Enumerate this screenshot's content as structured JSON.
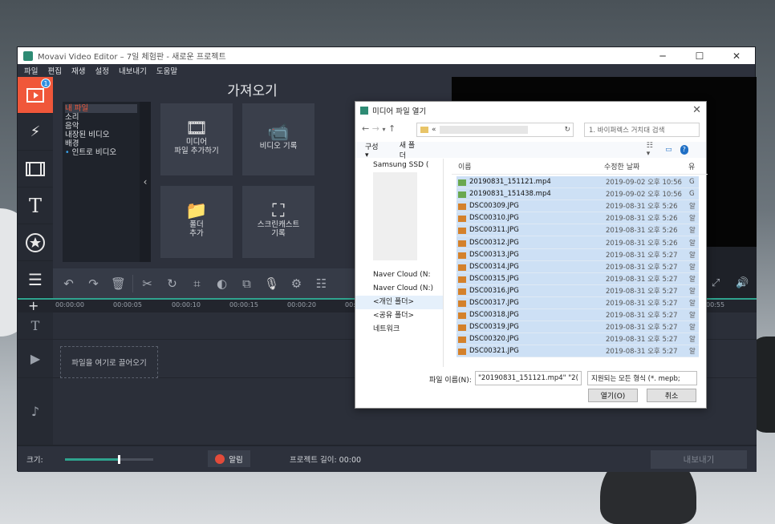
{
  "window": {
    "title": "Movavi Video Editor – 7일 체험판 - 새로운 프로젝트",
    "controls": [
      "─",
      "☐",
      "✕"
    ]
  },
  "menu": [
    "파일",
    "편집",
    "재생",
    "설정",
    "내보내기",
    "도움말"
  ],
  "sidebar": {
    "badge": "1"
  },
  "import": {
    "title": "가져오기",
    "sources": [
      "내 파일",
      "소리",
      "음악",
      "내장된 비디오",
      "배경",
      "인트로 비디오"
    ],
    "tiles": {
      "add_files": [
        "미디어",
        "파일 추가하기"
      ],
      "record_video": "비디오 기록",
      "add_folder": [
        "폴더",
        "추가"
      ],
      "screencast": [
        "스크린캐스트",
        "기록"
      ]
    }
  },
  "timeline": {
    "ticks": [
      "00:00:00",
      "00:00:05",
      "00:00:10",
      "00:00:15",
      "00:00:20",
      "00:",
      "00:55"
    ],
    "drop_hint": "파일을 여기로 끌어오기"
  },
  "status": {
    "size_label": "크기:",
    "zoom": 0.62,
    "notify": "알림",
    "project_length": "프로젝트 길이: 00:00",
    "export": "내보내기"
  },
  "dialog": {
    "title": "미디어 파일 열기",
    "address": "«",
    "search_placeholder": "1. 바이퍼렉스 거치대 검색",
    "cmd": [
      "구성 ▾",
      "새 폴더"
    ],
    "tree": [
      "Samsung SSD (",
      "Naver Cloud (N:",
      "Naver Cloud (N:)",
      "<개인 폴더>",
      "<공유 폴더>",
      "네트워크"
    ],
    "columns": {
      "name": "이름",
      "date": "수정한 날짜",
      "type": "유"
    },
    "files": [
      {
        "name": "20190831_151121.mp4",
        "date": "2019-09-02 오후 10:56",
        "type": "G",
        "kind": "mp4"
      },
      {
        "name": "20190831_151438.mp4",
        "date": "2019-09-02 오후 10:56",
        "type": "G",
        "kind": "mp4"
      },
      {
        "name": "DSC00309.JPG",
        "date": "2019-08-31 오후 5:26",
        "type": "알",
        "kind": "jpg"
      },
      {
        "name": "DSC00310.JPG",
        "date": "2019-08-31 오후 5:26",
        "type": "알",
        "kind": "jpg"
      },
      {
        "name": "DSC00311.JPG",
        "date": "2019-08-31 오후 5:26",
        "type": "알",
        "kind": "jpg"
      },
      {
        "name": "DSC00312.JPG",
        "date": "2019-08-31 오후 5:26",
        "type": "알",
        "kind": "jpg"
      },
      {
        "name": "DSC00313.JPG",
        "date": "2019-08-31 오후 5:27",
        "type": "알",
        "kind": "jpg"
      },
      {
        "name": "DSC00314.JPG",
        "date": "2019-08-31 오후 5:27",
        "type": "알",
        "kind": "jpg"
      },
      {
        "name": "DSC00315.JPG",
        "date": "2019-08-31 오후 5:27",
        "type": "알",
        "kind": "jpg"
      },
      {
        "name": "DSC00316.JPG",
        "date": "2019-08-31 오후 5:27",
        "type": "알",
        "kind": "jpg"
      },
      {
        "name": "DSC00317.JPG",
        "date": "2019-08-31 오후 5:27",
        "type": "알",
        "kind": "jpg"
      },
      {
        "name": "DSC00318.JPG",
        "date": "2019-08-31 오후 5:27",
        "type": "알",
        "kind": "jpg"
      },
      {
        "name": "DSC00319.JPG",
        "date": "2019-08-31 오후 5:27",
        "type": "알",
        "kind": "jpg"
      },
      {
        "name": "DSC00320.JPG",
        "date": "2019-08-31 오후 5:27",
        "type": "알",
        "kind": "jpg"
      },
      {
        "name": "DSC00321.JPG",
        "date": "2019-08-31 오후 5:27",
        "type": "알",
        "kind": "jpg"
      }
    ],
    "filename_label": "파일 이름(N):",
    "filename_value": "\"20190831_151121.mp4\" \"2(",
    "filetype": "지원되는 모든 형식 (*. mepb;",
    "open": "열기(O)",
    "cancel": "취소"
  }
}
